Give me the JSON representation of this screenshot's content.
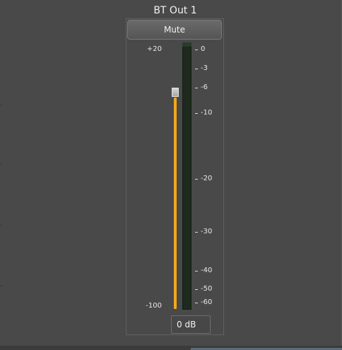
{
  "channel": {
    "title": "BT Out 1",
    "mute_label": "Mute",
    "value_display": "0 dB"
  },
  "fader": {
    "max_label": "+20",
    "min_label": "-100",
    "range_db": [
      -100,
      20
    ],
    "value_db": 0,
    "track_color": "#f0a81c"
  },
  "meter": {
    "scale_labels": [
      {
        "db": 0,
        "label": "0"
      },
      {
        "db": -3,
        "label": "-3"
      },
      {
        "db": -6,
        "label": "-6"
      },
      {
        "db": -10,
        "label": "-10"
      },
      {
        "db": -20,
        "label": "-20"
      },
      {
        "db": -30,
        "label": "-30"
      },
      {
        "db": -40,
        "label": "-40"
      },
      {
        "db": -50,
        "label": "-50"
      },
      {
        "db": -60,
        "label": "-60"
      }
    ],
    "background_color": "#1d2a1d"
  },
  "colors": {
    "panel_background": "#494949",
    "text": "#f2f2f2"
  }
}
